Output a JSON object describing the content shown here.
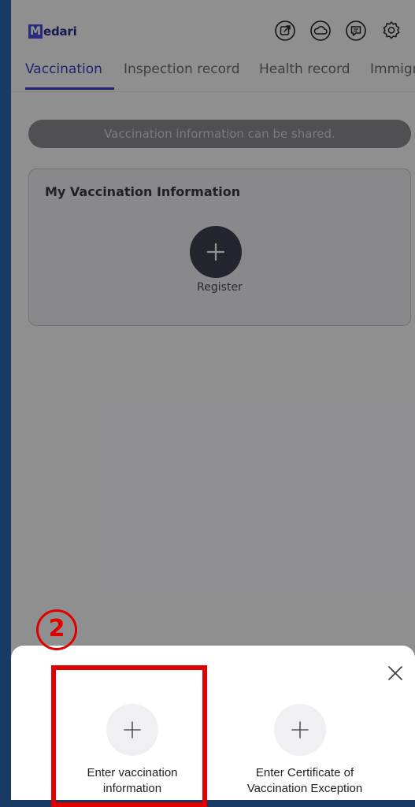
{
  "app": {
    "logo_text": "edari",
    "logo_initial": "M"
  },
  "header_icons": [
    "share-icon",
    "cloud-icon",
    "message-icon",
    "settings-icon"
  ],
  "tabs": [
    {
      "label": "Vaccination",
      "active": true
    },
    {
      "label": "Inspection record",
      "active": false
    },
    {
      "label": "Health record",
      "active": false
    },
    {
      "label": "Immigr",
      "active": false
    }
  ],
  "banner": {
    "text": "Vaccination information can be shared."
  },
  "card": {
    "title": "My Vaccination Information",
    "register_label": "Register"
  },
  "sheet": {
    "options": [
      {
        "label": "Enter vaccination\ninformation",
        "icon": "plus-icon"
      },
      {
        "label": "Enter Certificate of\nVaccination Exception",
        "icon": "plus-icon"
      }
    ]
  },
  "annotation": {
    "step": "2",
    "color": "#e00000"
  },
  "colors": {
    "accent": "#3a3ac0",
    "page_bg": "#1a3a66"
  }
}
